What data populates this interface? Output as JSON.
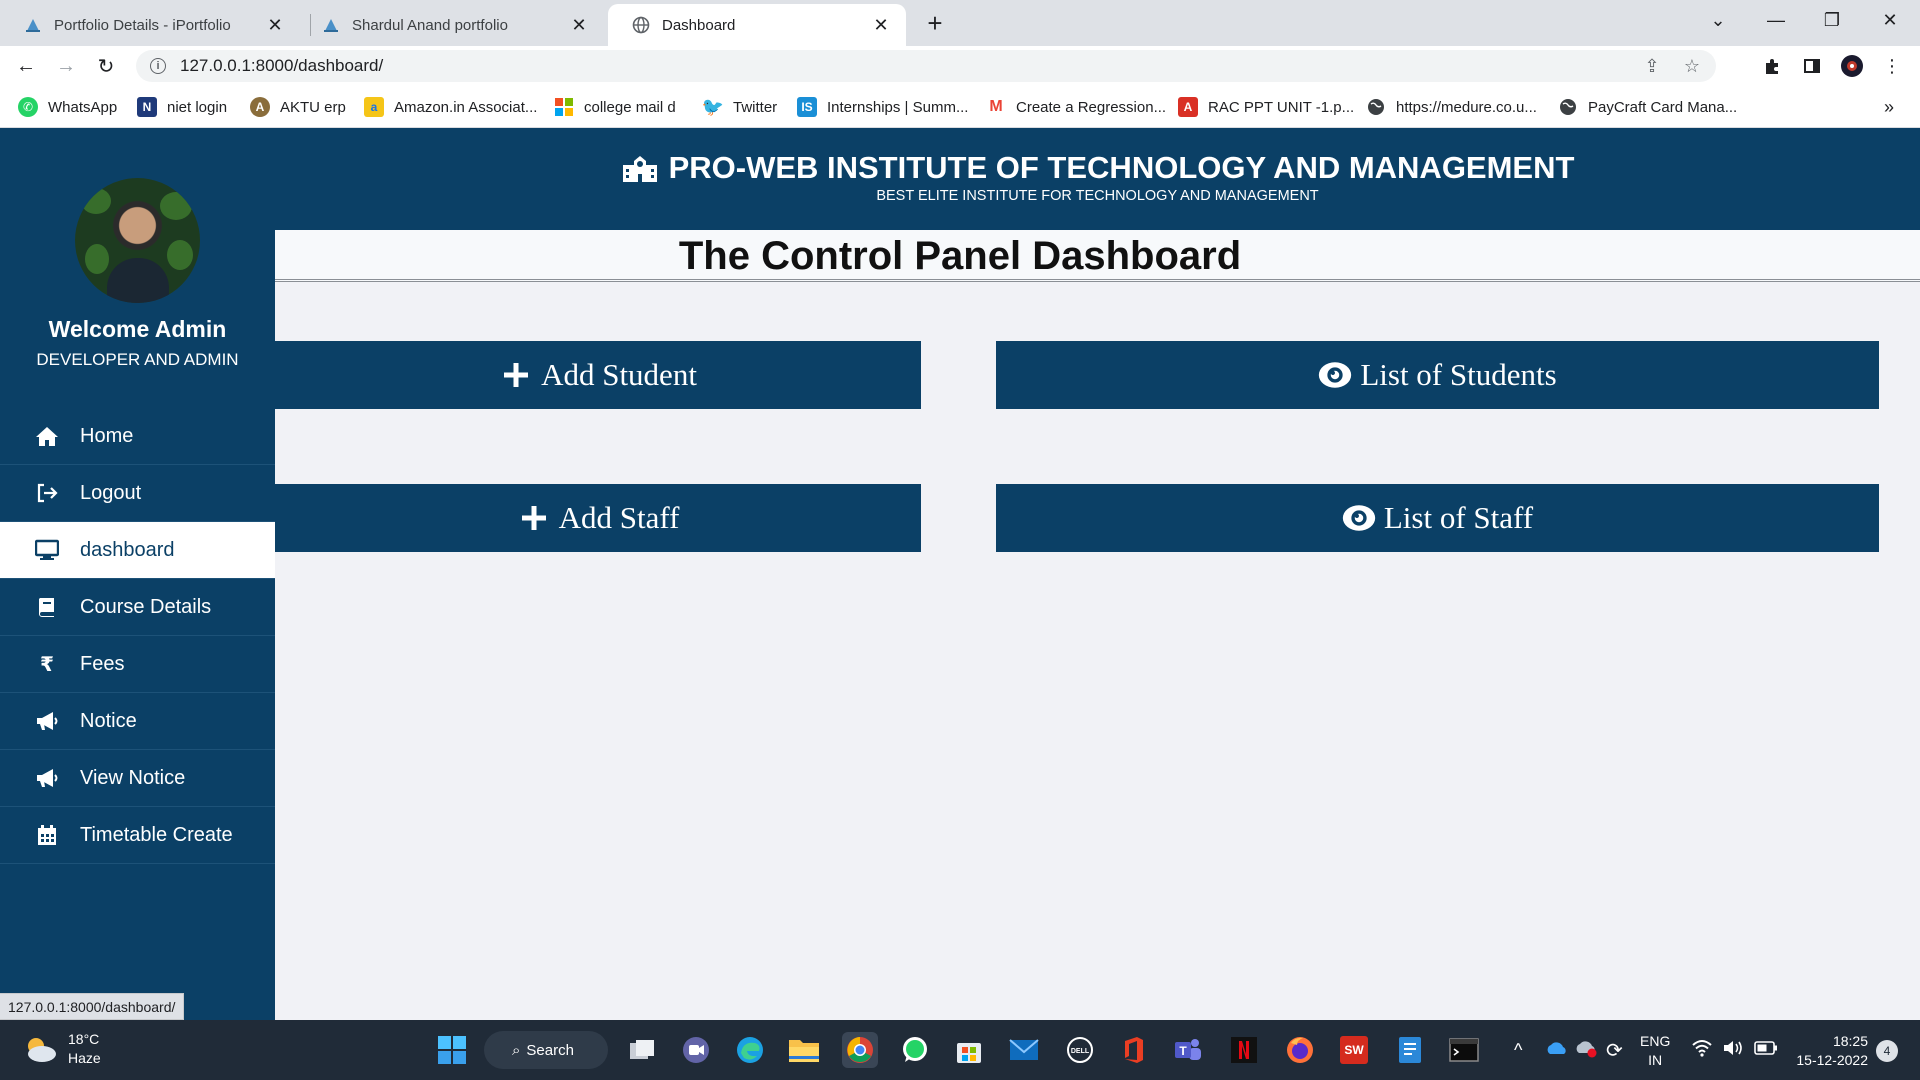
{
  "browser": {
    "tabs": [
      {
        "title": "Portfolio Details - iPortfolio",
        "icon": "portfolio-favicon"
      },
      {
        "title": "Shardul Anand portfolio",
        "icon": "portfolio-favicon"
      },
      {
        "title": "Dashboard",
        "icon": "globe-icon"
      }
    ],
    "url": "127.0.0.1:8000/dashboard/",
    "bookmarks": [
      {
        "label": "WhatsApp",
        "icon": "whatsapp-icon"
      },
      {
        "label": "niet login",
        "icon": "niet-icon"
      },
      {
        "label": "AKTU erp",
        "icon": "aktu-icon"
      },
      {
        "label": "Amazon.in Associat...",
        "icon": "amazon-icon"
      },
      {
        "label": "college mail d",
        "icon": "microsoft-icon"
      },
      {
        "label": "Twitter",
        "icon": "twitter-icon"
      },
      {
        "label": "Internships | Summ...",
        "icon": "internshala-icon"
      },
      {
        "label": "Create a Regression...",
        "icon": "gmail-icon"
      },
      {
        "label": "RAC PPT UNIT -1.p...",
        "icon": "pdf-icon"
      },
      {
        "label": "https://medure.co.u...",
        "icon": "globe-icon"
      },
      {
        "label": "PayCraft Card Mana...",
        "icon": "globe-icon"
      }
    ],
    "status_url": "127.0.0.1:8000/dashboard/"
  },
  "header": {
    "institute": "PRO-WEB INSTITUTE OF TECHNOLOGY AND MANAGEMENT",
    "tagline": "BEST ELITE INSTITUTE FOR TECHNOLOGY AND MANAGEMENT"
  },
  "sidebar": {
    "welcome": "Welcome Admin",
    "role": "DEVELOPER AND ADMIN",
    "items": [
      {
        "label": "Home",
        "icon": "home-icon"
      },
      {
        "label": "Logout",
        "icon": "logout-icon"
      },
      {
        "label": "dashboard",
        "icon": "desktop-icon",
        "active": true
      },
      {
        "label": "Course Details",
        "icon": "book-icon"
      },
      {
        "label": "Fees",
        "icon": "rupee-icon"
      },
      {
        "label": "Notice",
        "icon": "megaphone-icon"
      },
      {
        "label": "View Notice",
        "icon": "megaphone-icon"
      },
      {
        "label": "Timetable Create",
        "icon": "calendar-icon"
      }
    ]
  },
  "main": {
    "title": "The Control Panel Dashboard",
    "buttons": {
      "add_student": "Add Student",
      "list_students": "List of Students",
      "add_staff": "Add Staff",
      "list_staff": "List of Staff"
    }
  },
  "taskbar": {
    "weather_temp": "18°C",
    "weather_desc": "Haze",
    "search_label": "Search",
    "lang_top": "ENG",
    "lang_bottom": "IN",
    "time": "18:25",
    "date": "15-12-2022",
    "notifications": "4"
  },
  "colors": {
    "brand": "#0b4066",
    "page_bg": "#f1f2f6"
  }
}
